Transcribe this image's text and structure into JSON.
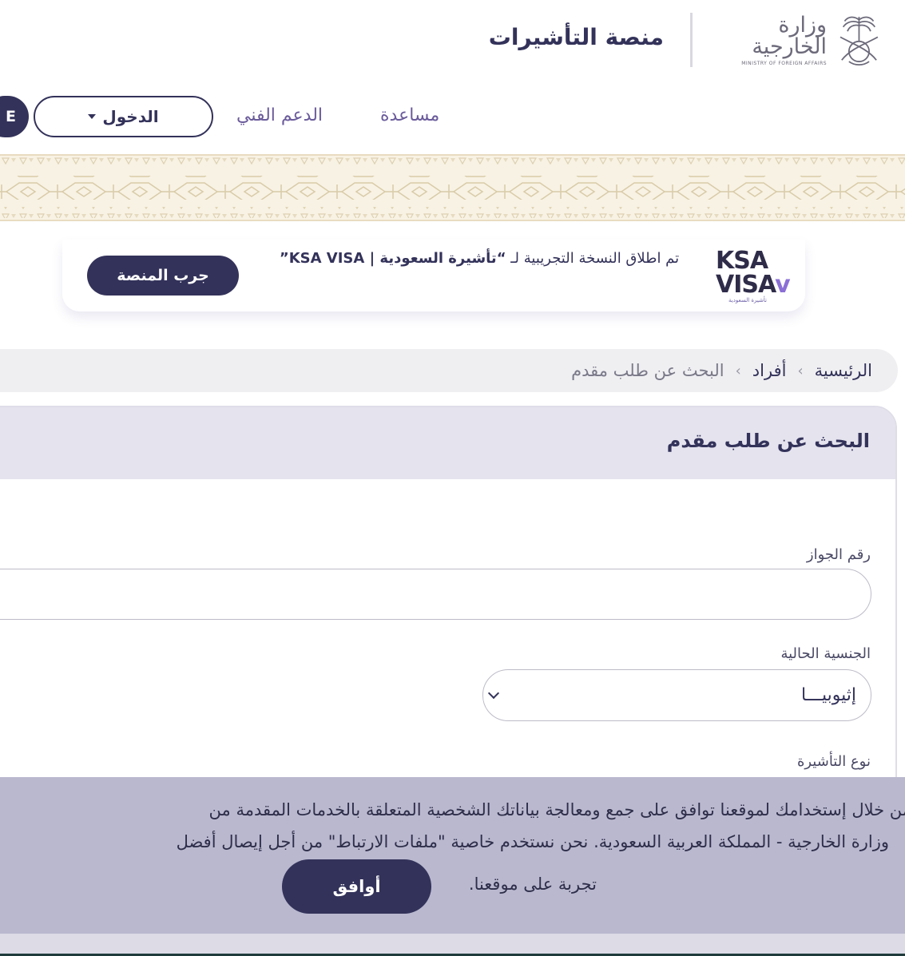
{
  "header": {
    "ministry_ar": "وزارة الخارجية",
    "ministry_en": "MINISTRY OF FOREIGN AFFAIRS",
    "platform_title": "منصة التأشيرات"
  },
  "nav": {
    "help": "مساعدة",
    "support": "الدعم الفني",
    "login": "الدخول",
    "language": "E"
  },
  "announcement": {
    "ksa_line1": "KSA",
    "ksa_line2": "VISA",
    "ksa_sub": "تأشيرة السعودية",
    "text_prefix": "تم اطلاق النسخة التجريبية لـ ",
    "text_bold": "“تأشيرة السعودية | KSA VISA”",
    "try_button": "جرب المنصة"
  },
  "breadcrumb": {
    "home": "الرئيسية",
    "individuals": "أفراد",
    "current": "البحث عن طلب مقدم"
  },
  "form": {
    "title": "البحث عن طلب مقدم",
    "passport_label": "رقم الجواز",
    "passport_value": "",
    "nationality_label": "الجنسية الحالية",
    "nationality_value": "إثيوبيـــا",
    "visa_type_label": "نوع التأشيرة"
  },
  "cookie": {
    "line1": "من خلال إستخدامك لموقعنا توافق على جمع ومعالجة بياناتك الشخصية المتعلقة بالخدمات المقدمة من",
    "line2": "وزارة الخارجية - المملكة العربية السعودية. نحن نستخدم خاصية \"ملفات الارتباط\" من أجل إيصال أفضل",
    "line3": "تجربة على موقعنا.",
    "agree_button": "أوافق"
  },
  "colors": {
    "primary": "#33325a",
    "accent": "#6a5b9b",
    "card_header": "#e4e3ee",
    "cookie_bg": "#b9b8cf",
    "ornament_bg": "#f8f2e4"
  }
}
